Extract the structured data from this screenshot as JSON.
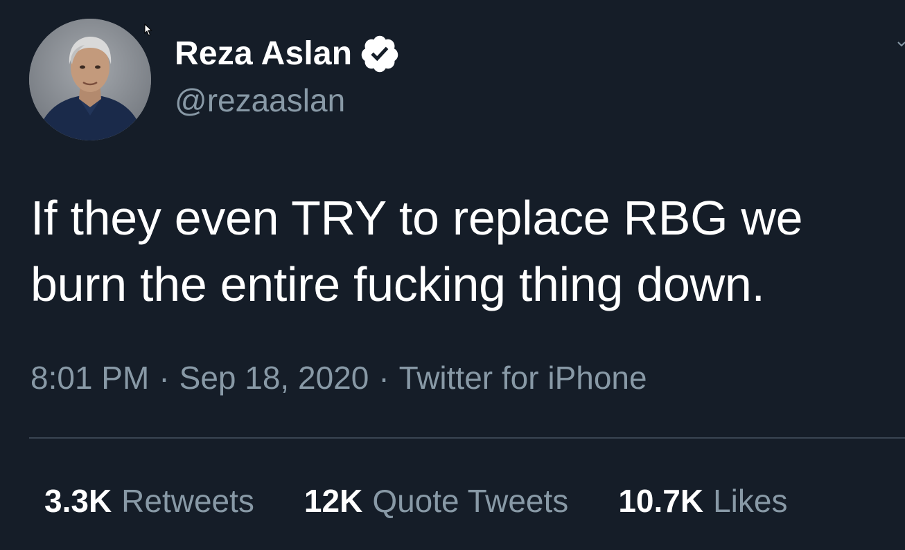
{
  "author": {
    "display_name": "Reza Aslan",
    "handle": "@rezaaslan",
    "verified": true
  },
  "tweet": {
    "text": "If they even TRY to replace RBG we burn the entire fucking thing down.",
    "time": "8:01 PM",
    "date": "Sep 18, 2020",
    "source": "Twitter for iPhone",
    "separator": "·"
  },
  "stats": {
    "retweets": {
      "count": "3.3K",
      "label": "Retweets"
    },
    "quote_tweets": {
      "count": "12K",
      "label": "Quote Tweets"
    },
    "likes": {
      "count": "10.7K",
      "label": "Likes"
    }
  },
  "colors": {
    "background": "#151d28",
    "primary_text": "#ffffff",
    "secondary_text": "#8899a6",
    "divider": "#3a4552"
  },
  "icons": {
    "verified": "verified-badge-icon",
    "cursor": "mouse-pointer-icon",
    "more": "chevron-down-icon"
  }
}
